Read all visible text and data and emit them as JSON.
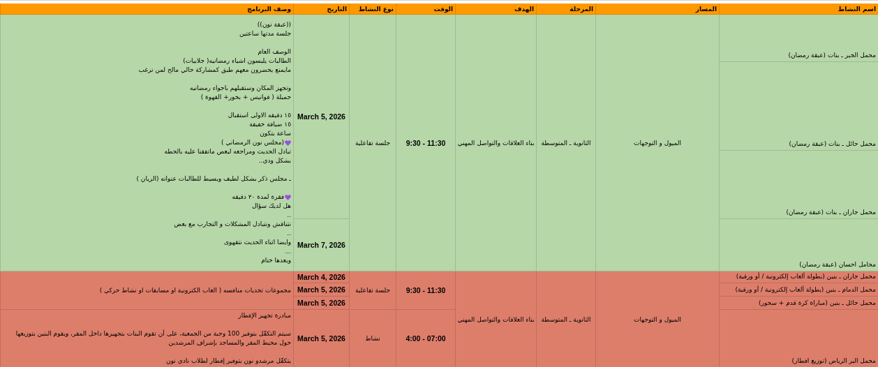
{
  "columns": [
    "اسم النشاط",
    "المسار",
    "المرحلة",
    "الهدف",
    "الوقت",
    "نوع النشاط",
    "التاريخ",
    "وصف البرنامج"
  ],
  "sections": [
    {
      "color": "#b6d7a8",
      "track": "الميول و التوجهات",
      "stage": "الثانوية ـ المتوسطة",
      "goal": "بناء العلاقات والتواصل المهني",
      "blocks": [
        {
          "type": "جلسة تفاعلية",
          "time": "9:30 - 11:30",
          "description": [
            [
              {
                "text": "((عبقة نون))",
                "heart": false
              },
              {
                "text": "جلسة مدتها ساعتين",
                "heart": false
              }
            ],
            [
              {
                "text": "الوصف العام",
                "heart": false
              },
              {
                "text": "الطالبات يلبسون اشياء رمضانيه( جلابيات)",
                "heart": false
              },
              {
                "text": "مايمنع يحضرون معهم طبق كمشاركة حالي مالح لمن ترغب",
                "heart": false
              }
            ],
            [
              {
                "text": "وتجهز المكان وستقبلهم باجواء رمضانيه",
                "heart": false
              },
              {
                "text": "جميلة ( فوانيس + بخور+ القهوة )",
                "heart": false
              }
            ],
            [
              {
                "text": "١٥ دقيقه  الاولى استقبال",
                "heart": false
              },
              {
                "text": "١٥ ضيافة خفيفة",
                "heart": false
              },
              {
                "text": "ساعة بتكون",
                "heart": false
              },
              {
                "text": "(مجلس نون الرمضاني )",
                "heart": true
              },
              {
                "text": "تبادل الحديث ومراجعه لبعض ماتفقنا عليه بالحطه",
                "heart": false
              },
              {
                "text": "بشكل ودي..",
                "heart": false
              }
            ],
            [
              {
                "text": "ـ مجلس ذكر بشكل لطيف وبسيط للطالبات عنوانه (الريان )",
                "heart": false
              }
            ],
            [
              {
                "text": "فقرة لمدة ٢٠ دقيقه",
                "heart": true
              },
              {
                "text": "هل لديك سؤال",
                "heart": false
              },
              {
                "text": "..",
                "heart": false
              },
              {
                "text": "نتناقش ونتبادل المشكلات و  التجارب مع بعض",
                "heart": false
              },
              {
                "text": "..",
                "heart": false
              },
              {
                "text": "وايضا اثناء الحديث نتقهوى",
                "heart": false
              },
              {
                "text": "...",
                "heart": false
              },
              {
                "text": "وبعدها ختام",
                "heart": false
              }
            ]
          ],
          "dates": [
            {
              "date": "March 5, 2026",
              "activities": [
                "محمل الخبر ـ بنات (عبقة رمضان)",
                "محمل حائل ـ بنات (عبقة رمضان)",
                "محمل جاران ـ بنات (عبقة رمضان)"
              ]
            },
            {
              "date": "March 7, 2026",
              "activities": [
                "محامل احسان  (عبقة رمضان)"
              ]
            }
          ]
        }
      ]
    },
    {
      "color": "#dd7e6b",
      "track": "الميول و التوجهات",
      "stage": "الثانوية ـ المتوسطة",
      "goal": "بناء العلاقات والتواصل المهني",
      "blocks": [
        {
          "type": "جلسة تفاعلية",
          "time": "9:30 - 11:30",
          "description": [
            [
              {
                "text": "مجموعات تحديات منافسه ( العاب الكترونية او مسابقات او نشاط حركي )",
                "heart": false
              }
            ]
          ],
          "dates": [
            {
              "date": "March 4, 2026",
              "activities": [
                "محمل جاران ـ بنين (بطولة ألعاب إلكترونية / أو ورقية)"
              ]
            },
            {
              "date": "March 5, 2026",
              "activities": [
                "محمل الدمام ـ بنين (بطولة ألعاب إلكترونية / أو ورقية)"
              ]
            },
            {
              "date": "March 5, 2026",
              "activities": [
                "محمل حائل ـ بنين (مباراة كرة قدم + سحور)"
              ]
            }
          ]
        },
        {
          "type": "نشاط",
          "time": "4:00 - 07:00",
          "description": [
            [
              {
                "text": "مبادرة تجهيز الإفطار",
                "heart": false
              }
            ],
            [
              {
                "text": "سيتم التكفّل بتوفير 100 وجبة من الجمعية، على أن تقوم البنات بتجهيزها داخل المقر، ويقوم البنين بتوزيعها حول محيط المقر والمساجد بإشراف المرشدين",
                "heart": false
              }
            ],
            [
              {
                "text": "يتكفّل مرشدو نون بتوفير إفطار لطلاب نادي نون",
                "heart": false
              }
            ]
          ],
          "dates": [
            {
              "date": "March 5, 2026",
              "activities": [
                "محمل البر الرياض  (توزيع افطار)"
              ]
            }
          ]
        }
      ]
    }
  ]
}
